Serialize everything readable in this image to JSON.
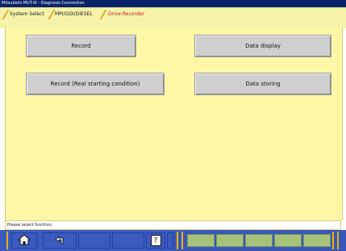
{
  "window": {
    "title": "Mitsubishi MUT-III - Diagnosis Connection"
  },
  "breadcrumb": {
    "items": [
      "System Select",
      "MPI/GDI/DIESEL",
      "Drive Recorder"
    ]
  },
  "main": {
    "buttons": [
      "Record",
      "Data display",
      "Record (Real starting condition)",
      "Data storing"
    ]
  },
  "status": {
    "text": "Please select function."
  },
  "toolbar": {
    "help_label": "?"
  }
}
